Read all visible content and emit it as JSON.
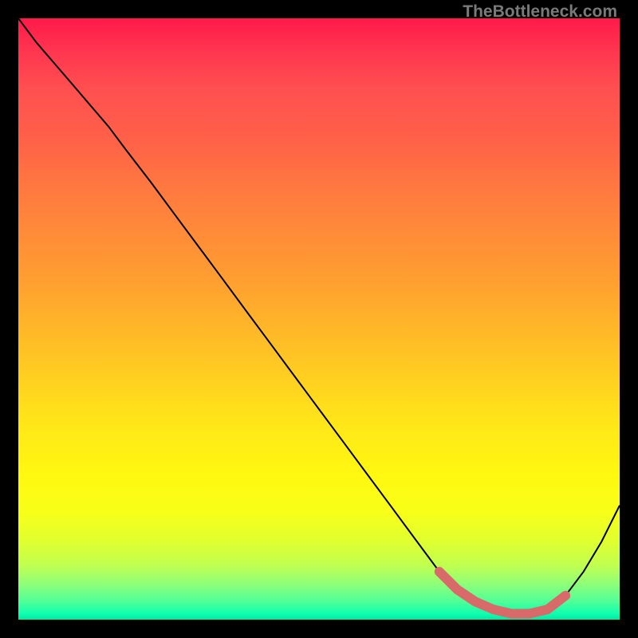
{
  "attribution": "TheBottleneck.com",
  "chart_data": {
    "type": "line",
    "title": "",
    "xlabel": "",
    "ylabel": "",
    "xlim": [
      0,
      100
    ],
    "ylim": [
      0,
      100
    ],
    "series": [
      {
        "name": "bottleneck-curve",
        "x": [
          0,
          3,
          6,
          9,
          12,
          15,
          18,
          22,
          26,
          30,
          34,
          38,
          42,
          46,
          50,
          54,
          58,
          62,
          66,
          70,
          73,
          76,
          79,
          82,
          85,
          88,
          91,
          94,
          97,
          100
        ],
        "y": [
          100,
          96,
          92.5,
          89,
          85.5,
          82,
          78,
          72.8,
          67.4,
          62,
          56.6,
          51.2,
          45.8,
          40.4,
          35,
          29.6,
          24.2,
          18.8,
          13.4,
          8,
          5,
          3,
          1.7,
          1,
          1,
          1.7,
          4,
          8,
          13,
          19
        ]
      },
      {
        "name": "optimal-highlight",
        "x": [
          70,
          73,
          76,
          79,
          82,
          85,
          88,
          91
        ],
        "y": [
          8,
          5,
          3,
          1.7,
          1,
          1,
          1.7,
          4
        ]
      }
    ],
    "background": {
      "type": "vertical-gradient",
      "stops": [
        {
          "pos": 0,
          "color": "#ff1a4a"
        },
        {
          "pos": 50,
          "color": "#ffb020"
        },
        {
          "pos": 80,
          "color": "#f8ff18"
        },
        {
          "pos": 100,
          "color": "#00e8a0"
        }
      ]
    }
  }
}
